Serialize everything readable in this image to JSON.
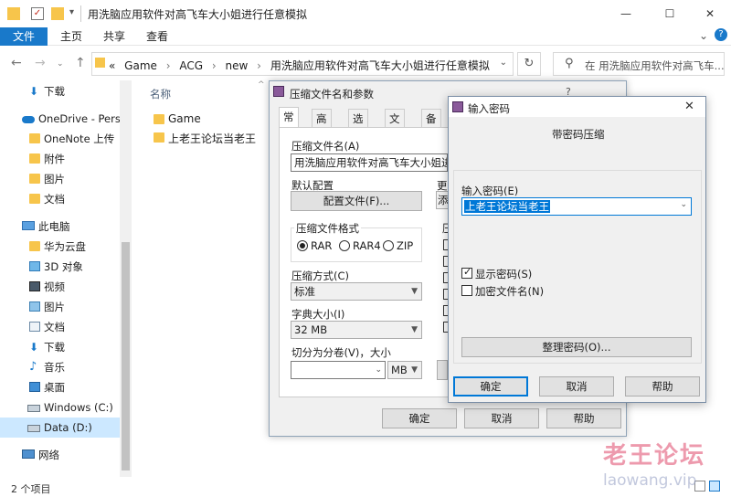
{
  "window": {
    "title": "用洗脑应用软件对高飞车大小姐进行任意模拟",
    "controls": {
      "minimize": "—",
      "maximize": "☐",
      "close": "✕"
    }
  },
  "ribbon": {
    "file": "文件",
    "tabs": [
      "主页",
      "共享",
      "查看"
    ],
    "expand": "⌄",
    "help": "?"
  },
  "address": {
    "breadcrumbs": [
      "«",
      "Game",
      "›",
      "ACG",
      "›",
      "new",
      "›",
      "用洗脑应用软件对高飞车大小姐进行任意模拟"
    ],
    "search_placeholder": "在 用洗脑应用软件对高飞车..."
  },
  "sidebar": {
    "items": [
      {
        "label": "下载",
        "icon": "download-icon"
      },
      {
        "label": "OneDrive - Perso",
        "icon": "onedrive-cloud-icon"
      },
      {
        "label": "OneNote 上传",
        "icon": "folder-icon"
      },
      {
        "label": "附件",
        "icon": "folder-icon"
      },
      {
        "label": "图片",
        "icon": "folder-icon"
      },
      {
        "label": "文档",
        "icon": "folder-icon"
      },
      {
        "label": "此电脑",
        "icon": "pc-icon"
      },
      {
        "label": "华为云盘",
        "icon": "folder-icon"
      },
      {
        "label": "3D 对象",
        "icon": "cube-icon"
      },
      {
        "label": "视频",
        "icon": "video-icon"
      },
      {
        "label": "图片",
        "icon": "picture-icon"
      },
      {
        "label": "文档",
        "icon": "document-icon"
      },
      {
        "label": "下载",
        "icon": "download-icon"
      },
      {
        "label": "音乐",
        "icon": "music-icon"
      },
      {
        "label": "桌面",
        "icon": "desktop-icon"
      },
      {
        "label": "Windows (C:)",
        "icon": "drive-c-icon"
      },
      {
        "label": "Data (D:)",
        "icon": "drive-icon"
      },
      {
        "label": "网络",
        "icon": "network-icon"
      }
    ]
  },
  "content": {
    "column_name": "名称",
    "files": [
      "Game",
      "上老王论坛当老王"
    ]
  },
  "status": {
    "count": "2 个项目"
  },
  "archive_dialog": {
    "title": "压缩文件名和参数",
    "help": "?",
    "tabs": [
      "常规",
      "高级",
      "选项",
      "文件",
      "备份"
    ],
    "archive_name_label": "压缩文件名(A)",
    "archive_name_value": "用洗脑应用软件对高飞车大小姐进行",
    "default_profile_label": "默认配置",
    "profile_button": "配置文件(F)...",
    "update_label": "更",
    "update_combo": "添",
    "format_label": "压缩文件格式",
    "formats": [
      "RAR",
      "RAR4",
      "ZIP"
    ],
    "selected_format": "RAR",
    "options_label": "压",
    "method_label": "压缩方式(C)",
    "method_value": "标准",
    "dict_label": "字典大小(I)",
    "dict_value": "32 MB",
    "split_label": "切分为分卷(V)，大小",
    "split_value": "",
    "split_unit": "MB",
    "ok": "确定",
    "cancel": "取消",
    "help_button": "帮助"
  },
  "password_dialog": {
    "title": "输入密码",
    "close": "✕",
    "heading": "带密码压缩",
    "password_label": "输入密码(E)",
    "password_value": "上老王论坛当老王",
    "show_password": "显示密码(S)",
    "show_password_checked": true,
    "encrypt_names": "加密文件名(N)",
    "encrypt_names_checked": false,
    "organize_button": "整理密码(O)...",
    "ok": "确定",
    "cancel": "取消",
    "help": "帮助"
  },
  "watermark": {
    "line1": "老王论坛",
    "line2": "laowang.vip"
  }
}
